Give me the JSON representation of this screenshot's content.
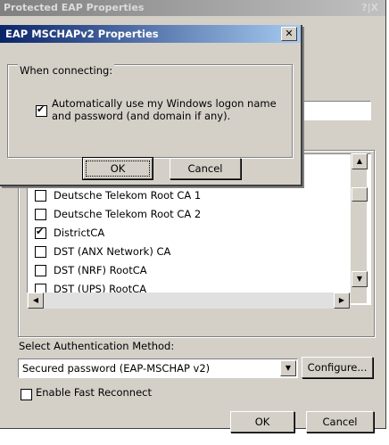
{
  "parent_dialog": {
    "title": "Protected EAP Properties",
    "help_close": "?|X",
    "trusted_roots": [
      {
        "label": "Deutsche Telekom Root CA 1",
        "checked": false
      },
      {
        "label": "Deutsche Telekom Root CA 2",
        "checked": false
      },
      {
        "label": "DistrictCA",
        "checked": true
      },
      {
        "label": "DST (ANX Network) CA",
        "checked": false
      },
      {
        "label": "DST (NRF) RootCA",
        "checked": false
      },
      {
        "label": "DST (UPS) RootCA",
        "checked": false
      }
    ],
    "auth_method_label": "Select Authentication Method:",
    "auth_method_value": "Secured password (EAP-MSCHAP v2)",
    "configure_label": "Configure...",
    "fast_reconnect_label": "Enable Fast Reconnect",
    "fast_reconnect_checked": false,
    "ok_label": "OK",
    "cancel_label": "Cancel"
  },
  "child_dialog": {
    "title": "EAP MSCHAPv2 Properties",
    "close_glyph": "✕",
    "group_label": "When connecting:",
    "auto_logon_label": "Automatically use my Windows logon name and password (and domain if any).",
    "auto_logon_checked": true,
    "ok_label": "OK",
    "cancel_label": "Cancel"
  }
}
